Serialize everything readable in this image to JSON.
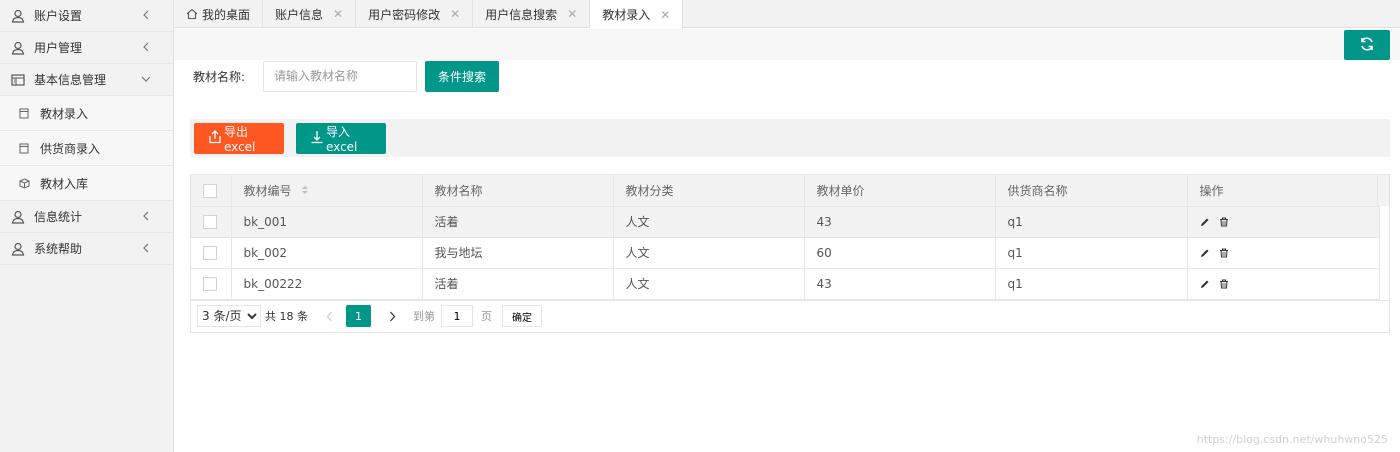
{
  "sidebar": {
    "items": [
      {
        "label": "账户设置",
        "icon": "user-icon",
        "arrow": "chevron-left-icon"
      },
      {
        "label": "用户管理",
        "icon": "user-icon",
        "arrow": "chevron-left-icon"
      },
      {
        "label": "基本信息管理",
        "icon": "grid-icon",
        "arrow": "chevron-down-icon",
        "children": [
          {
            "label": "教材录入",
            "icon": "doc-icon"
          },
          {
            "label": "供货商录入",
            "icon": "doc-icon"
          },
          {
            "label": "教材入库",
            "icon": "cube-icon"
          }
        ]
      },
      {
        "label": "信息统计",
        "icon": "user-icon",
        "arrow": "chevron-left-icon"
      },
      {
        "label": "系统帮助",
        "icon": "user-icon",
        "arrow": "chevron-left-icon"
      }
    ]
  },
  "tabs": [
    {
      "label": "我的桌面",
      "icon": "home-icon",
      "close": ""
    },
    {
      "label": "账户信息",
      "close": "✕"
    },
    {
      "label": "用户密码修改",
      "close": "✕"
    },
    {
      "label": "用户信息搜索",
      "close": "✕"
    },
    {
      "label": "教材录入",
      "close": "✕",
      "active": true
    }
  ],
  "search": {
    "label": "教材名称:",
    "placeholder": "请输入教材名称",
    "value": "",
    "button": "条件搜索"
  },
  "toolbar": {
    "export_label": "导出excel",
    "import_label": "导入excel"
  },
  "table": {
    "columns": [
      "教材编号",
      "教材名称",
      "教材分类",
      "教材单价",
      "供货商名称",
      "操作"
    ],
    "rows": [
      {
        "id": "bk_001",
        "name": "活着",
        "category": "人文",
        "price": "43",
        "supplier": "q1"
      },
      {
        "id": "bk_002",
        "name": "我与地坛",
        "category": "人文",
        "price": "60",
        "supplier": "q1"
      },
      {
        "id": "bk_00222",
        "name": "活着",
        "category": "人文",
        "price": "43",
        "supplier": "q1"
      }
    ]
  },
  "pager": {
    "page_size": "3 条/页",
    "page_size_options": [
      "3 条/页"
    ],
    "total": "共 18 条",
    "current": "1",
    "goto_label": "到第",
    "goto_value": "1",
    "page_unit": "页",
    "ok_label": "确定"
  },
  "colors": {
    "primary": "#009688",
    "danger": "#ff5722"
  },
  "watermark": "https://blog.csdn.net/whuhwno525"
}
